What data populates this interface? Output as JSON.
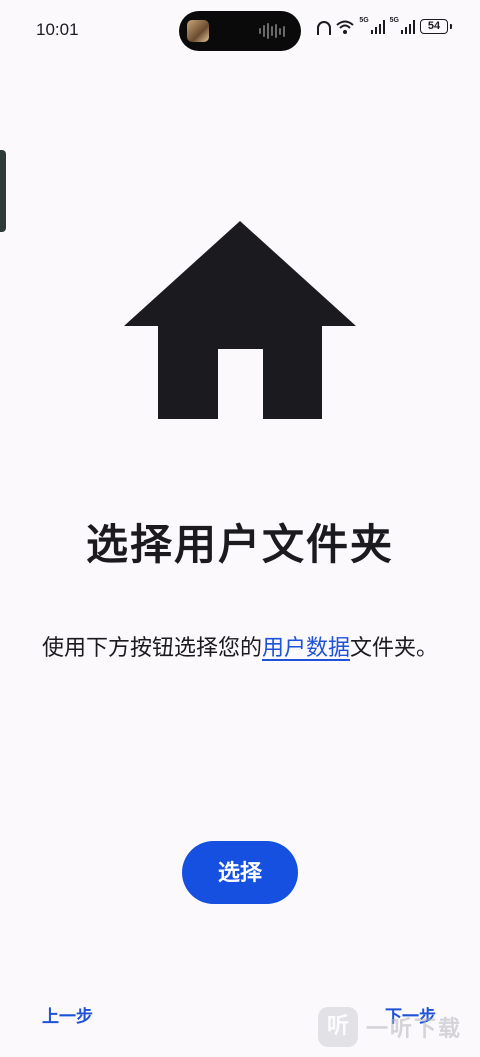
{
  "status_bar": {
    "time": "10:01",
    "network_1": "5G",
    "network_2": "5G",
    "battery": "54"
  },
  "main": {
    "illustration_icon": "home-icon",
    "title": "选择用户文件夹",
    "description_before": "使用下方按钮选择您的",
    "description_link": "用户数据",
    "description_after": "文件夹。",
    "select_button_label": "选择"
  },
  "footer": {
    "prev_label": "上一步",
    "next_label": "下一步"
  },
  "watermark": {
    "mark": "听",
    "text": "一听下载"
  },
  "colors": {
    "accent": "#1650e0",
    "link": "#1e53d6",
    "text": "#1b1a1e",
    "background": "#fbf9fc"
  }
}
